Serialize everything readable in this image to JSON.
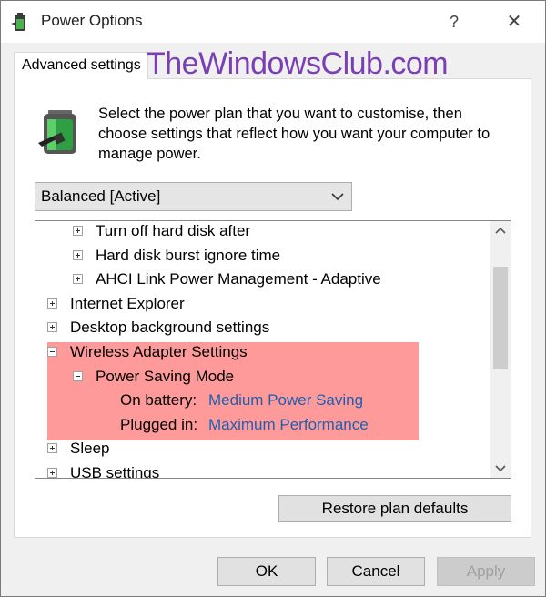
{
  "window": {
    "title": "Power Options",
    "help_glyph": "?",
    "close_glyph": "✕"
  },
  "tab": {
    "label": "Advanced settings"
  },
  "watermark": "TheWindowsClub.com",
  "description": "Select the power plan that you want to customise, then choose settings that reflect how you want your computer to manage power.",
  "plan_select": {
    "value": "Balanced [Active]"
  },
  "tree": {
    "items": [
      {
        "label": "Turn off hard disk after",
        "level": 1,
        "expander": "plus"
      },
      {
        "label": "Hard disk burst ignore time",
        "level": 1,
        "expander": "plus"
      },
      {
        "label": "AHCI Link Power Management - Adaptive",
        "level": 1,
        "expander": "plus"
      },
      {
        "label": "Internet Explorer",
        "level": 0,
        "expander": "plus"
      },
      {
        "label": "Desktop background settings",
        "level": 0,
        "expander": "plus"
      },
      {
        "label": "Wireless Adapter Settings",
        "level": 0,
        "expander": "minus"
      },
      {
        "label": "Power Saving Mode",
        "level": 1,
        "expander": "minus"
      },
      {
        "label": "On battery:",
        "value": "Medium Power Saving",
        "level": 2
      },
      {
        "label": "Plugged in:",
        "value": "Maximum Performance",
        "level": 2
      },
      {
        "label": "Sleep",
        "level": 0,
        "expander": "plus"
      },
      {
        "label": "USB settings",
        "level": 0,
        "expander": "plus"
      }
    ],
    "highlight_color": "#ff9a9a",
    "value_color": "#1f5fb0"
  },
  "buttons": {
    "restore": "Restore plan defaults",
    "ok": "OK",
    "cancel": "Cancel",
    "apply": "Apply"
  },
  "icons": [
    "power-options-app-icon",
    "battery-plug-icon",
    "chevron-down-icon",
    "scroll-up-icon",
    "scroll-down-icon"
  ]
}
